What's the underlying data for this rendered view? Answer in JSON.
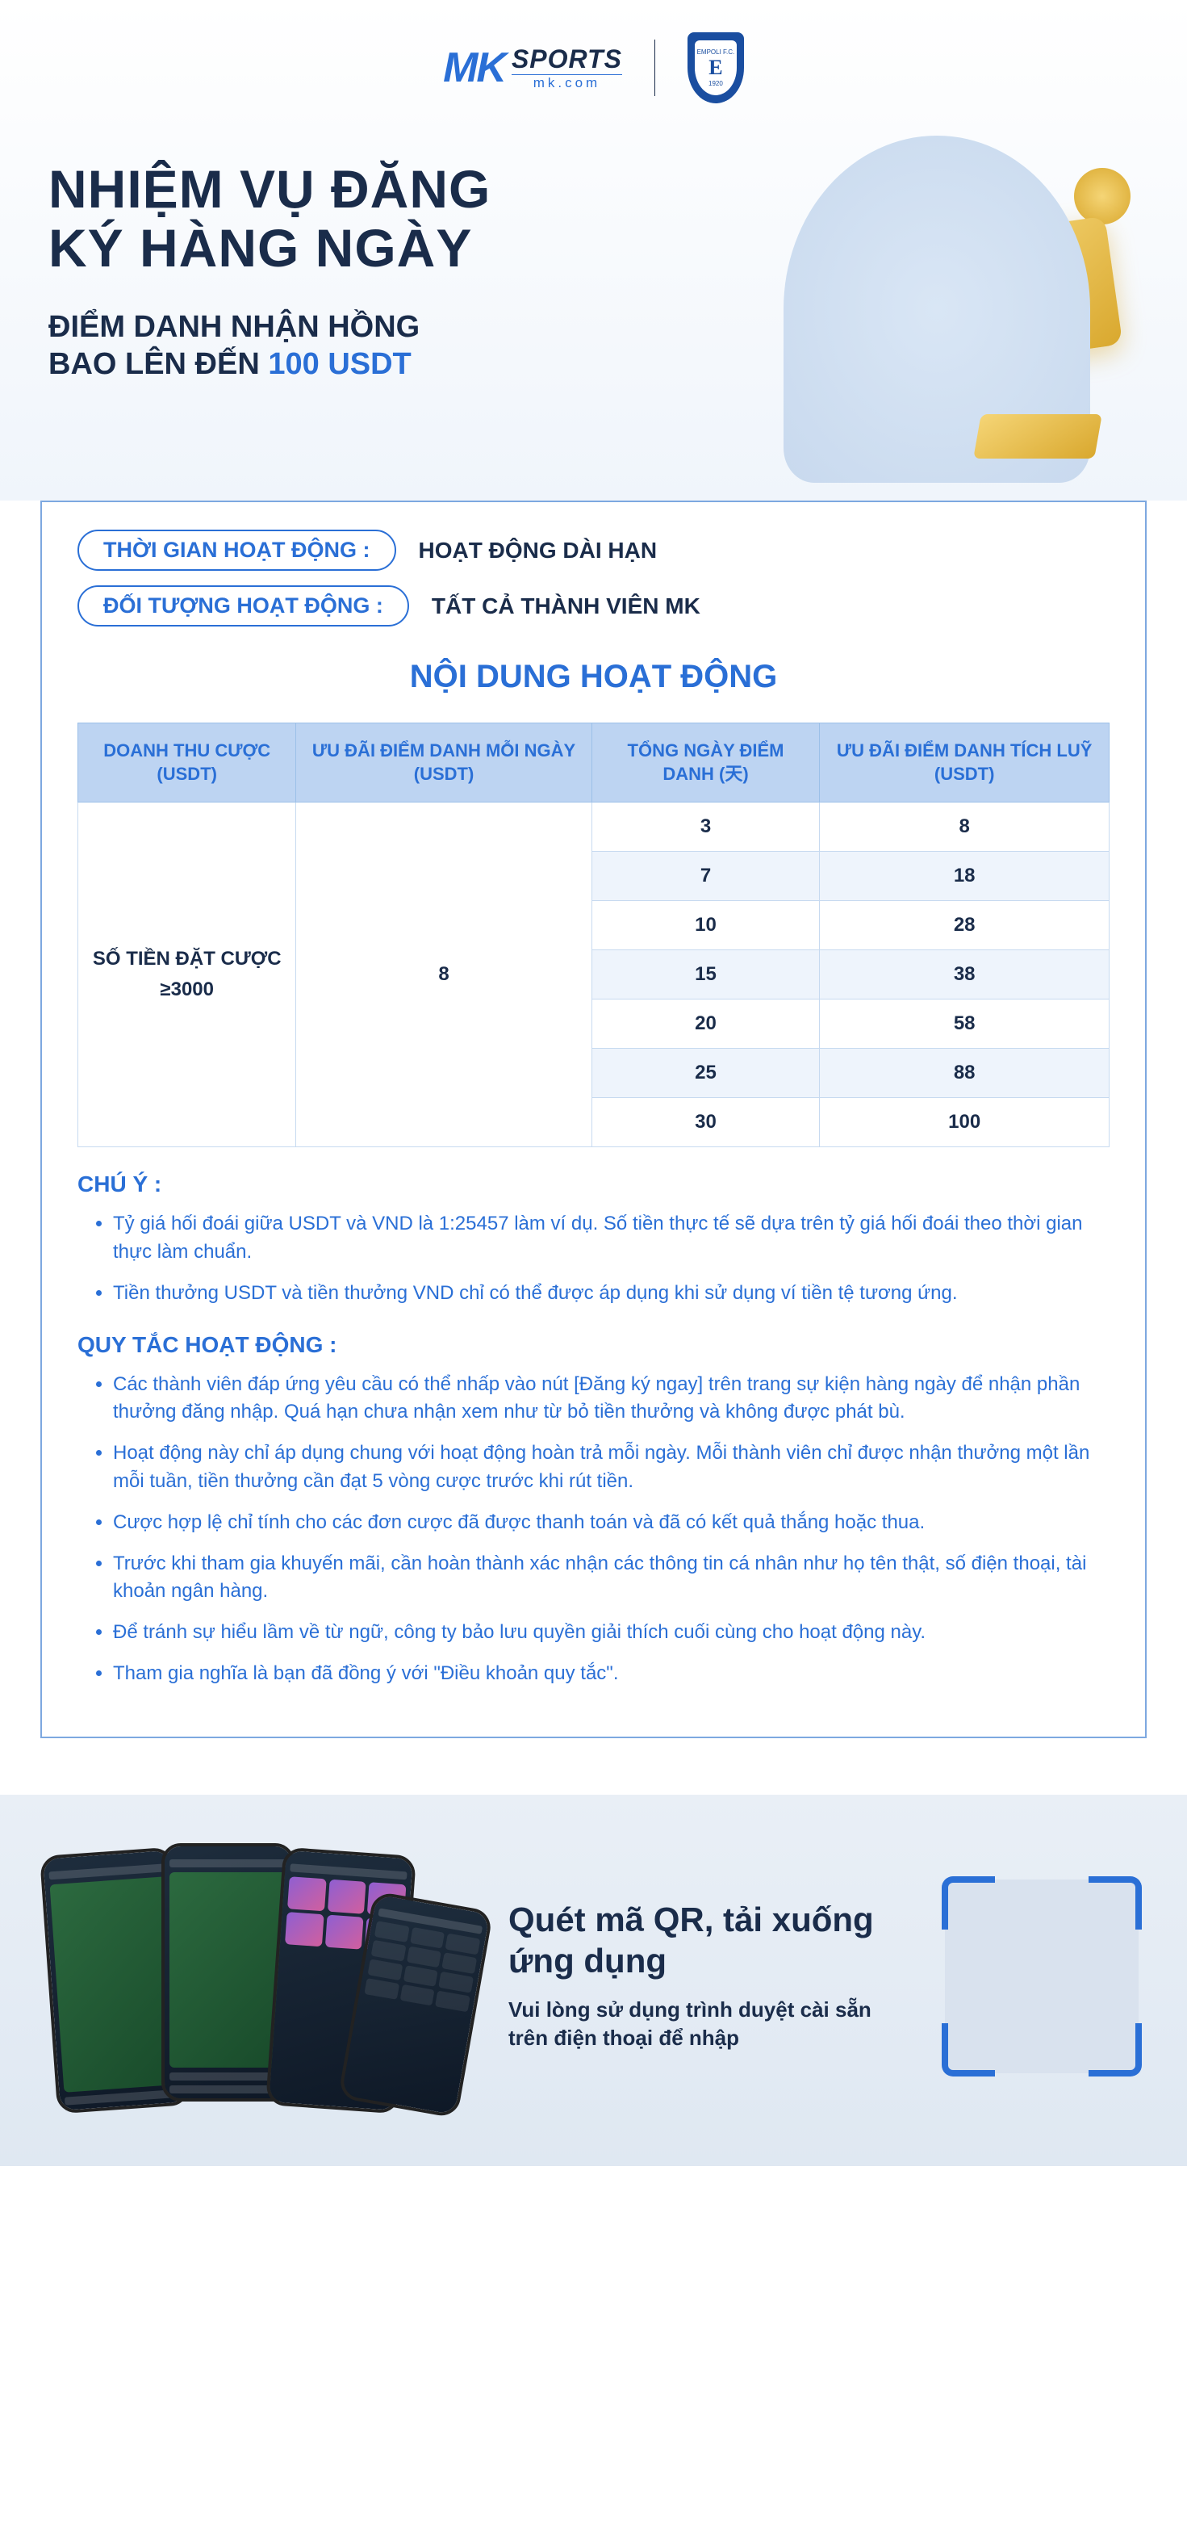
{
  "brand": {
    "mark": "MK",
    "name": "SPORTS",
    "url": "mk.com",
    "partner_badge_top": "EMPOLI F.C.",
    "partner_badge_letter": "E",
    "partner_badge_year": "1920"
  },
  "hero": {
    "title_line1": "NHIỆM VỤ ĐĂNG",
    "title_line2": "KÝ HÀNG NGÀY",
    "sub_line1": "ĐIỂM DANH NHẬN HỒNG",
    "sub_line2_a": "BAO LÊN ĐẾN ",
    "sub_line2_amount": "100 USDT"
  },
  "meta": {
    "time_label": "THỜI GIAN HOẠT ĐỘNG :",
    "time_value": "HOẠT ĐỘNG DÀI HẠN",
    "target_label": "ĐỐI TƯỢNG HOẠT ĐỘNG :",
    "target_value": "TẤT CẢ THÀNH VIÊN MK"
  },
  "section": {
    "content_title": "NỘI DUNG HOẠT ĐỘNG"
  },
  "table": {
    "headers": {
      "revenue": "DOANH THU CƯỢC (USDT)",
      "daily_bonus": "ƯU ĐÃI ĐIỂM DANH MỖI NGÀY (USDT)",
      "total_days": "TỔNG NGÀY ĐIỂM DANH (天)",
      "cumulative_bonus": "ƯU ĐÃI ĐIỂM DANH TÍCH LUỸ (USDT)"
    },
    "revenue_label_line1": "SỐ TIỀN ĐẶT CƯỢC",
    "revenue_label_line2": "≥3000",
    "daily_bonus_value": "8",
    "rows": [
      {
        "days": "3",
        "cum": "8"
      },
      {
        "days": "7",
        "cum": "18"
      },
      {
        "days": "10",
        "cum": "28"
      },
      {
        "days": "15",
        "cum": "38"
      },
      {
        "days": "20",
        "cum": "58"
      },
      {
        "days": "25",
        "cum": "88"
      },
      {
        "days": "30",
        "cum": "100"
      }
    ]
  },
  "notes": {
    "heading": "CHÚ Ý :",
    "items": [
      "Tỷ giá hối đoái giữa USDT và VND là 1:25457 làm ví dụ. Số tiền thực tế sẽ dựa trên tỷ giá hối đoái theo thời gian thực làm chuẩn.",
      "Tiền thưởng USDT và tiền thưởng VND chỉ có thể được áp dụng khi sử dụng ví tiền tệ tương ứng."
    ]
  },
  "rules": {
    "heading": "QUY TẮC HOẠT ĐỘNG :",
    "items": [
      "Các thành viên đáp ứng yêu cầu có thể nhấp vào nút [Đăng ký ngay] trên trang sự kiện hàng ngày để nhận phần thưởng đăng nhập. Quá hạn chưa nhận xem như từ bỏ tiền thưởng và không được phát bù.",
      "Hoạt động này chỉ áp dụng chung với hoạt động hoàn trả mỗi ngày. Mỗi thành viên chỉ được nhận thưởng một lần mỗi tuần, tiền thưởng cần đạt 5 vòng cược trước khi rút tiền.",
      "Cược hợp lệ chỉ tính cho các đơn cược đã được thanh toán và đã có kết quả thắng hoặc thua.",
      "Trước khi tham gia khuyến mãi, cần hoàn thành xác nhận các thông tin cá nhân như họ tên thật, số điện thoại, tài khoản ngân hàng.",
      "Để tránh sự hiểu lầm về từ ngữ, công ty bảo lưu quyền giải thích cuối cùng cho hoạt động này.",
      "Tham gia nghĩa là bạn đã đồng ý với \"Điều khoản quy tắc\"."
    ]
  },
  "footer": {
    "title": "Quét mã QR, tải xuống ứng dụng",
    "sub": "Vui lòng sử dụng trình duyệt cài sẵn trên điện thoại để nhập"
  }
}
